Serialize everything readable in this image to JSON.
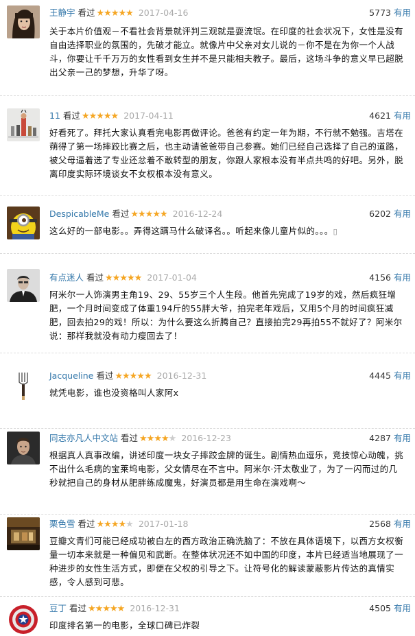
{
  "reviews": [
    {
      "user": "王静宇",
      "watched": "看过",
      "stars": 5,
      "date": "2017-04-16",
      "votes": "5773",
      "useful": "有用",
      "avatar": "portrait-short-hair-woman",
      "text": "关于本片价值观－不看社会背景就评判三观就是耍流氓。在印度的社会状况下，女性是没有自由选择职业的氛围的，先破才能立。就像片中父亲对女儿说的－你不是在为你一个人战斗，你要让千千万万的女性看到女生并不是只能相夫教子。最后，这场斗争的意义早已超脱出父亲一己的梦想，升华了呀。"
    },
    {
      "user": "11",
      "watched": "看过",
      "stars": 5,
      "date": "2017-04-11",
      "votes": "4621",
      "useful": "有用",
      "avatar": "figurines",
      "text": "好看死了。拜托大家认真看完电影再做评论。爸爸有约定一年为期，不行就不勉强。吉塔在蒴得了第一场摔跤比赛之后，也主动请爸爸带自己参赛。她们已经自己选择了自己的道路，被父母逼着选了专业还忿着不敢转型的朋友，你跟人家根本没有半点共鸣的好吧。另外，脱离印度实际环境谈女不女权根本没有意义。"
    },
    {
      "user": "DespicableMe",
      "watched": "看过",
      "stars": 5,
      "date": "2016-12-24",
      "votes": "6202",
      "useful": "有用",
      "avatar": "minion",
      "text": "这么好的一部电影。。弄得这蹒马什么破译名。。听起来像儿童片似的。。。",
      "emoji": "▯"
    },
    {
      "user": "有点迷人",
      "watched": "看过",
      "stars": 5,
      "date": "2017-01-04",
      "votes": "4156",
      "useful": "有用",
      "avatar": "man-in-suit",
      "text": "阿米尔一人饰演男主角19、29、55岁三个人生段。他首先完成了19岁的戏，然后疯狂增肥，一个月时间变成了体重194斤的55胖大爷，拍完老年戏后，又用5个月的时间疯狂减肥，回去拍29的戏！所以：为什么要这么折腾自己？直接拍完29再拍55不就好了？阿米尔说：那样我就没有动力瘦回去了！"
    },
    {
      "user": "Jacqueline",
      "watched": "看过",
      "stars": 5,
      "date": "2016-12-31",
      "votes": "4445",
      "useful": "有用",
      "avatar": "fork-pencil",
      "text": "就凭电影，谁也没资格叫人家阿x"
    },
    {
      "user": "同志亦凡人中文站",
      "watched": "看过",
      "stars": 4,
      "date": "2016-12-23",
      "votes": "4287",
      "useful": "有用",
      "avatar": "man-portrait",
      "text": "根据真人真事改编，讲述印度一块女子摔跤金牌的诞生。剧情热血逗乐，竞技惊心动魄，挑不出什么毛病的宝莱坞电影，父女情尽在不言中。阿米尔·汗太敬业了，为了一闪而过的几秒就把自己的身材从肥胖练成魔鬼，好演员都是用生命在演戏啊～"
    },
    {
      "user": "栗色雪",
      "watched": "看过",
      "stars": 4,
      "date": "2017-01-18",
      "votes": "2568",
      "useful": "有用",
      "avatar": "stage-scene",
      "text": "豆瓣文青们可能已经成功被白左的西方政治正确洗脑了：不放在具体语境下，以西方女权衡量一切本来就是一种偏见和武断。在整体状况还不如中国的印度，本片已经适当地展现了一种进步的女性生活方式，即便在父权的引导之下。让符号化的解读蒙蔽影片传达的真情实感，令人感到可悲。"
    },
    {
      "user": "豆丁",
      "watched": "看过",
      "stars": 5,
      "date": "2016-12-31",
      "votes": "4505",
      "useful": "有用",
      "avatar": "captain-america-shield",
      "text": "印度排名第一的电影，全球口碑已炸裂"
    }
  ]
}
